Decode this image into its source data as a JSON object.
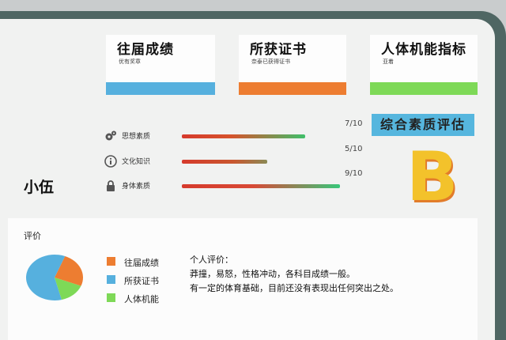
{
  "cards": [
    {
      "title": "往届成绩",
      "subtitle": "优有奖章",
      "color": "#56b0de"
    },
    {
      "title": "所获证书",
      "subtitle": "奈泰已获得证书",
      "color": "#ed7d31"
    },
    {
      "title": "人体机能指标",
      "subtitle": "亚着",
      "color": "#7ed957"
    }
  ],
  "student": {
    "name": "小伍"
  },
  "metrics": [
    {
      "label": "思想素质",
      "score_text": "7/10",
      "value": 0.7,
      "icon": "gears-icon"
    },
    {
      "label": "文化知识",
      "score_text": "5/10",
      "value": 0.5,
      "icon": "info-icon"
    },
    {
      "label": "身体素质",
      "score_text": "9/10",
      "value": 0.9,
      "icon": "lock-icon"
    }
  ],
  "evaluation": {
    "title": "综合素质评估",
    "grade": "B"
  },
  "review": {
    "title": "评价",
    "legend": [
      {
        "label": "往届成绩",
        "color": "#ed7d31"
      },
      {
        "label": "所获证书",
        "color": "#56b0de"
      },
      {
        "label": "人体机能",
        "color": "#7ed957"
      }
    ],
    "comment_heading": "个人评价：",
    "comment_lines": [
      "莽撞，易怒，性格冲动，各科目成绩一般。",
      "有一定的体育基础，目前还没有表现出任何突出之处。"
    ]
  },
  "chart_data": {
    "type": "pie",
    "labels": [
      "往届成绩",
      "所获证书",
      "人体机能"
    ],
    "values": [
      25,
      60,
      15
    ],
    "colors": [
      "#ed7d31",
      "#56b0de",
      "#7ed957"
    ]
  }
}
